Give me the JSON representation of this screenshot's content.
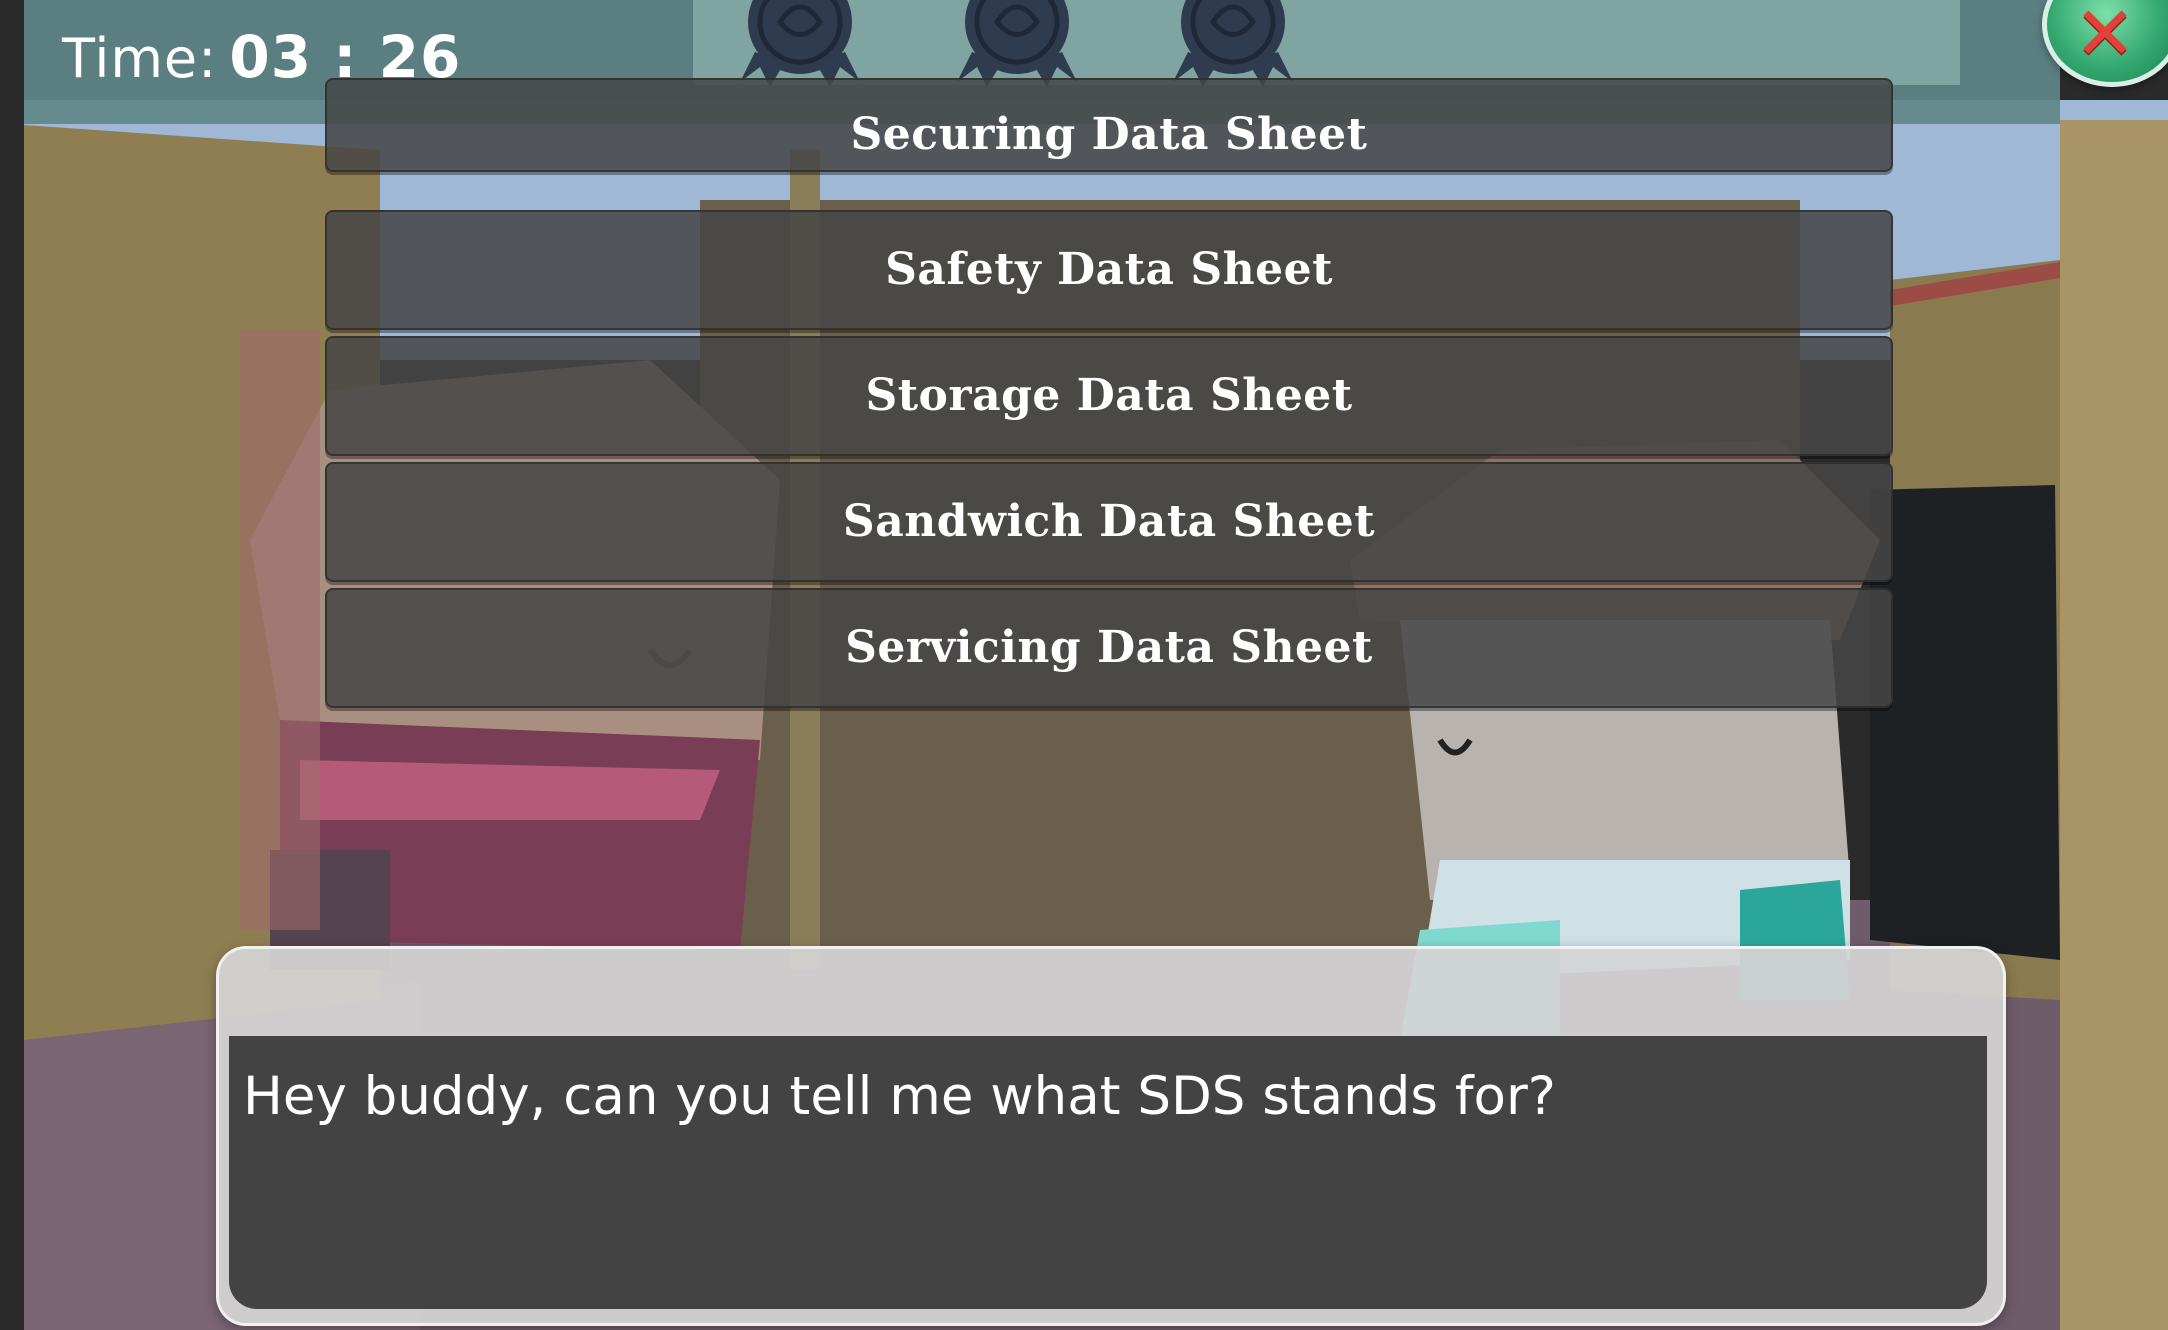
{
  "hud": {
    "time_label": "Time:",
    "time_value": "03 : 26",
    "badges": [
      {
        "icon": "award-badge-icon",
        "state": "locked"
      },
      {
        "icon": "award-badge-icon",
        "state": "locked"
      },
      {
        "icon": "award-badge-icon",
        "state": "locked"
      }
    ],
    "close_icon": "close-x-icon",
    "colors": {
      "hud_bar": "#608788",
      "badge_bar": "#87aaa8",
      "close_bg": "#33a870",
      "close_x": "#e4403a"
    }
  },
  "choices": [
    {
      "label": "Securing Data Sheet"
    },
    {
      "label": "Safety Data Sheet"
    },
    {
      "label": "Storage Data Sheet"
    },
    {
      "label": "Sandwich Data Sheet"
    },
    {
      "label": "Servicing Data Sheet"
    }
  ],
  "dialog": {
    "text": "Hey buddy, can you tell me what SDS stands for?"
  }
}
